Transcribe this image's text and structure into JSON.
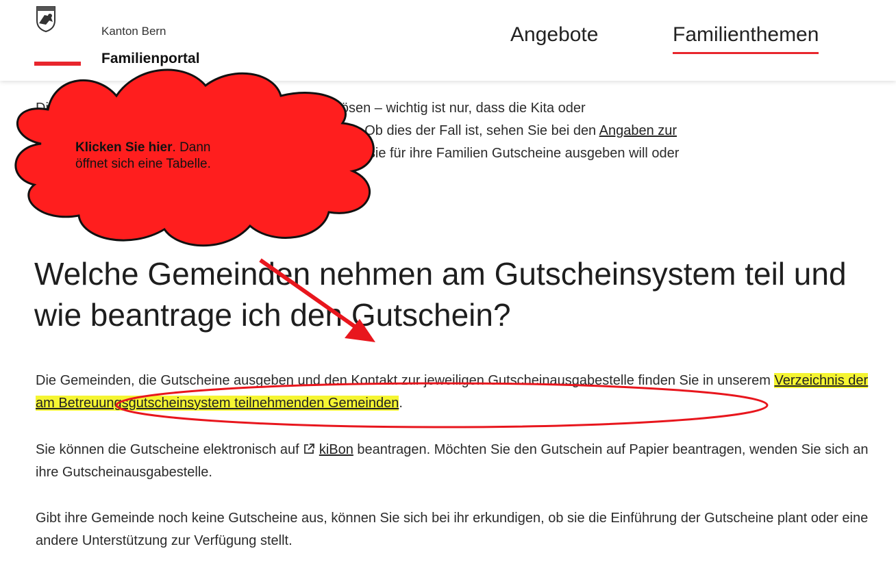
{
  "header": {
    "org": "Kanton Bern",
    "portal": "Familienportal",
    "nav": {
      "angebote": "Angebote",
      "familienthemen": "Familienthemen"
    },
    "accent": "#e8262d"
  },
  "content": {
    "intro": {
      "l1": "Die Gutscheine können Sie im ganzen Kanton einlösen – wichtig ist nur, dass die Kita oder",
      "l2a": "Tagesfamilie für das Gutscheinsystem zugelassen ist. Ob dies der Fall ist, sehen Sie bei den ",
      "l2link": "Angaben zur",
      "l3": "Betreuungsinstitution. Jede Gemeinde entscheidet, ob sie für ihre Familien Gutscheine ausgeben will oder"
    },
    "heading": "Welche Gemeinden nehmen am Gutscheinsystem teil und wie beantrage ich den Gutschein?",
    "p2a": "Die Gemeinden, die Gutscheine ausgeben und den Kontakt zur jeweiligen Gutscheinausgabestelle finden Sie in unserem ",
    "p2link": "Verzeichnis der am Betreuungsgutscheinsystem teilnehmenden Gemeinden",
    "p2end": ".",
    "p3a": "Sie können die Gutscheine elektronisch auf ",
    "p3link": "kiBon",
    "p3b": " beantragen. Möchten Sie den Gutschein auf Papier beantragen, wenden Sie sich an ihre Gutscheinausgabestelle.",
    "p4": "Gibt ihre Gemeinde noch keine Gutscheine aus, können Sie sich bei ihr erkundigen, ob sie die Einführung der Gutscheine plant oder eine andere Unterstützung zur Verfügung stellt."
  },
  "annotation": {
    "cloud_bold": "Klicken Sie hier",
    "cloud_rest": ". Dann öffnet sich eine Tabelle.",
    "color": "#e8161d",
    "highlight": "#f5f532"
  },
  "icons": {
    "logo": "bern-coat-of-arms",
    "external": "external-link-icon"
  }
}
